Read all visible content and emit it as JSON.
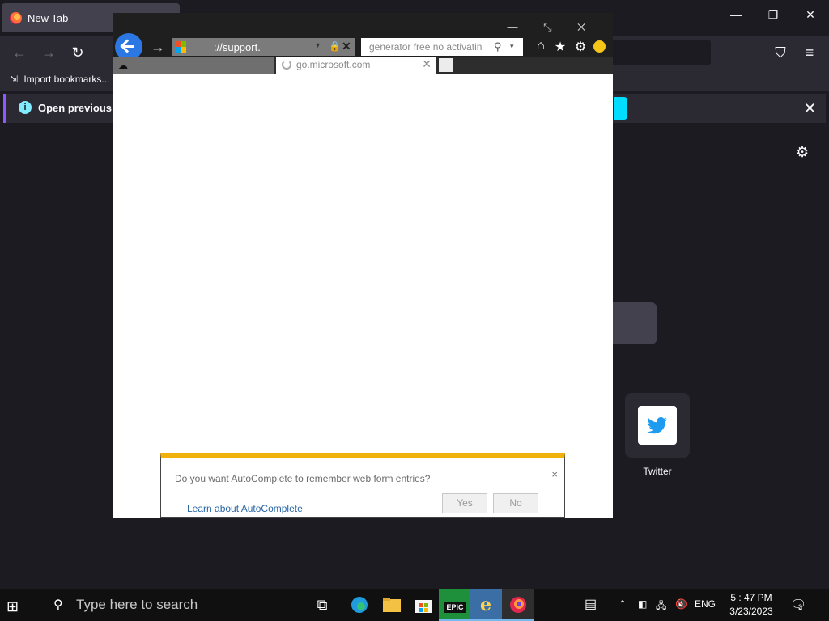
{
  "firefox": {
    "tab": {
      "title": "New Tab"
    },
    "window_controls": {
      "minimize": "—",
      "restore": "❐",
      "close": "✕"
    },
    "nav": {
      "back": "←",
      "forward": "→",
      "reload": "↻",
      "pocket": "⛉",
      "menu": "≡"
    },
    "bookmarks": {
      "import_label": "Import bookmarks..."
    },
    "infobar": {
      "message": "Open previous t",
      "close": "✕"
    },
    "gear": "⚙",
    "shortcut": {
      "label": "Twitter"
    }
  },
  "ie": {
    "window_controls": "— ⤡ ✕",
    "address": {
      "url": "://support.",
      "lock": "🔒",
      "stop": "✕",
      "dropdown": "▾"
    },
    "search": {
      "value": "generator free no activatin",
      "icon": "⚲",
      "dropdown": "▾"
    },
    "toolbar": {
      "home": "⌂",
      "favorites": "★",
      "tools": "⚙"
    },
    "tabs": [
      {
        "label": ""
      },
      {
        "label": "go.microsoft.com",
        "close": "✕"
      }
    ],
    "autocomplete": {
      "message": "Do you want AutoComplete to remember web form entries?",
      "learn_link": "Learn about AutoComplete",
      "yes_label": "Yes",
      "no_label": "No",
      "close": "×"
    }
  },
  "taskbar": {
    "search_placeholder": "Type here to search",
    "language": "ENG",
    "time": "5 : 47 PM",
    "date": "3/23/2023",
    "notification_count": "3",
    "epic_label": "EPIC"
  },
  "colors": {
    "firefox_bg": "#1c1b22",
    "ie_accent": "#2b78e4",
    "autocomplete_bar": "#f0b20a",
    "link": "#2866a6"
  }
}
